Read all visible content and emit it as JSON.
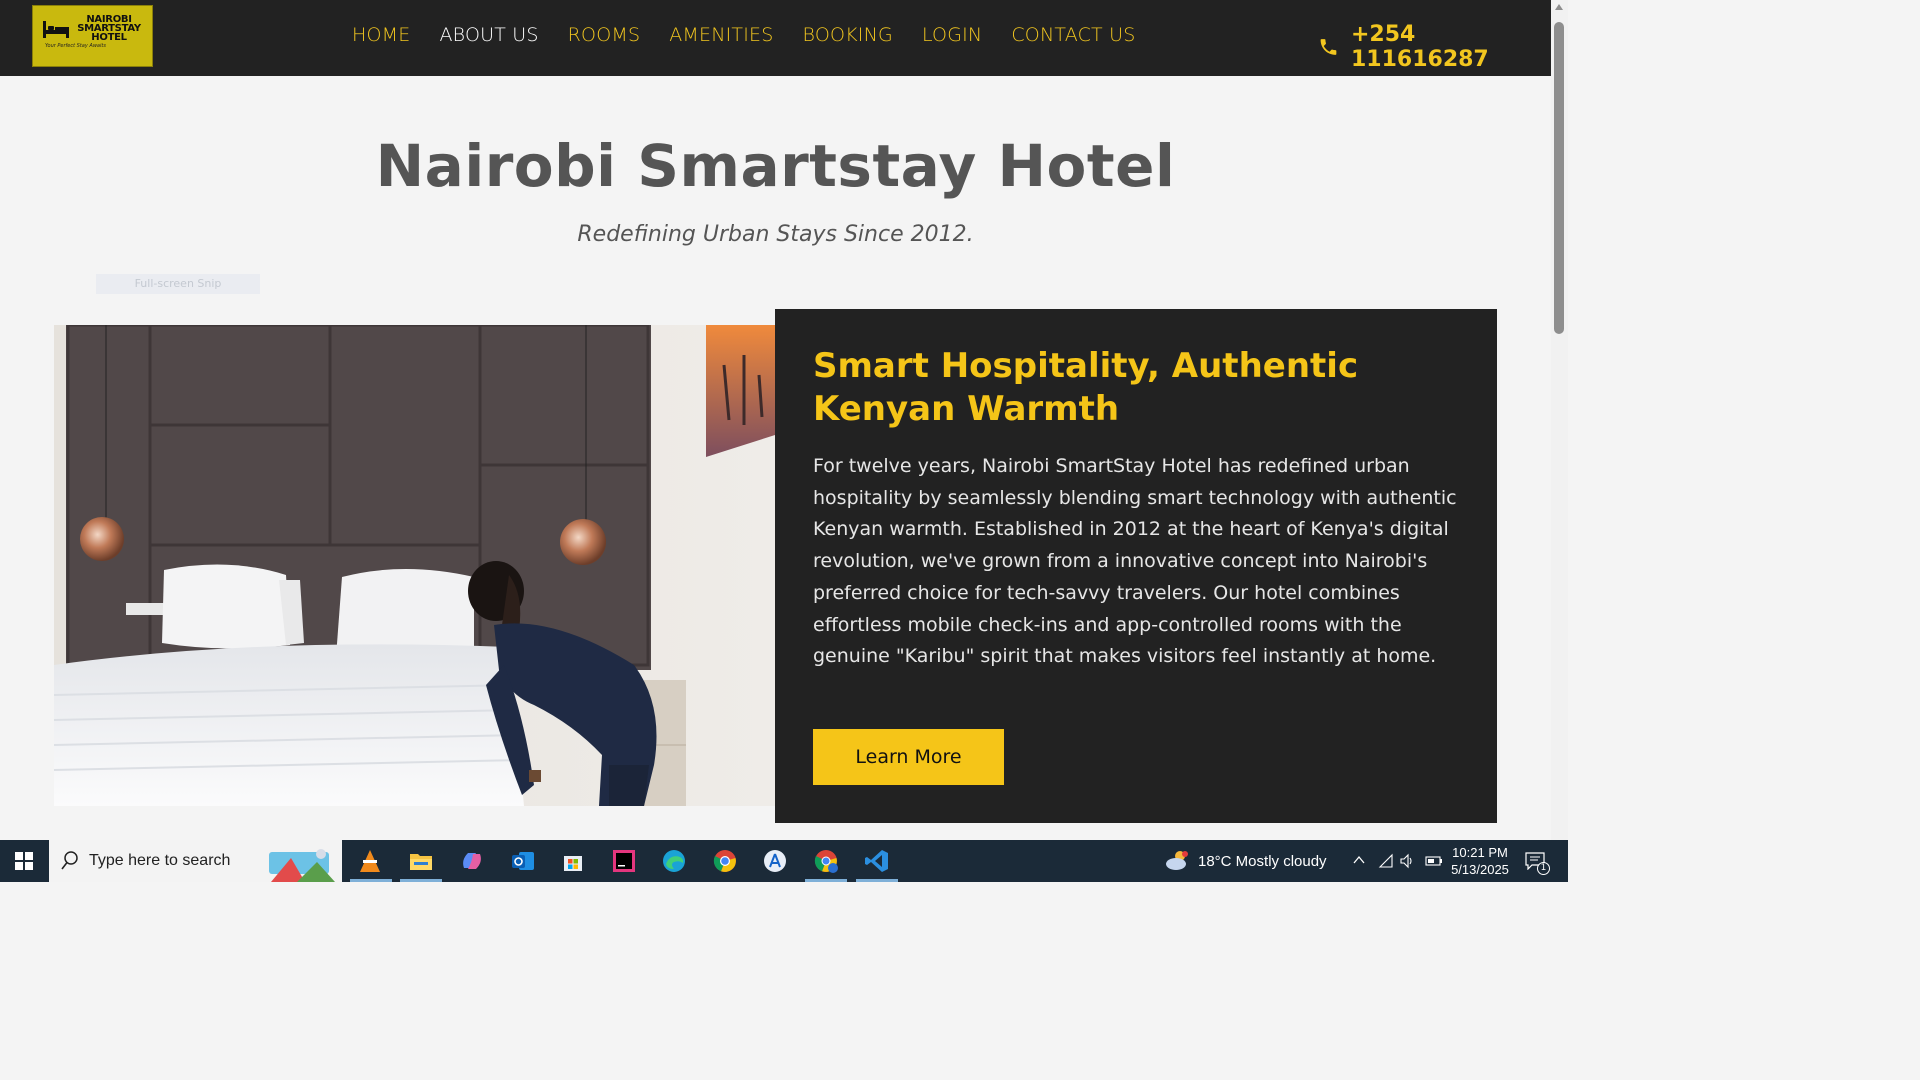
{
  "logo": {
    "line1": "NAIROBI",
    "line2": "SMARTSTAY",
    "line3": "HOTEL",
    "tagline": "Your Perfect Stay Awaits"
  },
  "nav": {
    "items": [
      {
        "label": "HOME"
      },
      {
        "label": "ABOUT US",
        "active": true
      },
      {
        "label": "ROOMS"
      },
      {
        "label": "AMENITIES"
      },
      {
        "label": "BOOKING"
      },
      {
        "label": "LOGIN"
      },
      {
        "label": "CONTACT US"
      }
    ],
    "phone": "+254 111616287"
  },
  "hero": {
    "title": "Nairobi Smartstay Hotel",
    "subtitle": "Redefining Urban Stays Since 2012."
  },
  "overlay": {
    "snip_label": "Full-screen Snip"
  },
  "about": {
    "heading": "Smart Hospitality, Authentic Kenyan Warmth",
    "body": "For twelve years, Nairobi SmartStay Hotel has redefined urban hospitality by seamlessly blending smart technology with authentic Kenyan warmth. Established in 2012 at the heart of Kenya's digital revolution, we've grown from a innovative concept into Nairobi's preferred choice for tech-savvy travelers. Our hotel combines effortless mobile check-ins and app-controlled rooms with the genuine \"Karibu\" spirit that makes visitors feel instantly at home.",
    "button": "Learn More"
  },
  "colors": {
    "accent": "#f5c518",
    "dark": "#222222",
    "heading_gray": "#555555"
  },
  "taskbar": {
    "search_placeholder": "Type here to search",
    "weather": "18°C  Mostly cloudy",
    "time": "10:21 PM",
    "date": "5/13/2025",
    "notifications": "1",
    "apps": [
      "vlc-icon",
      "file-explorer-icon",
      "copilot-icon",
      "outlook-icon",
      "store-icon",
      "intellij-icon",
      "edge-icon",
      "chrome-icon",
      "app-store-icon",
      "chrome-profile-icon",
      "vscode-icon"
    ]
  }
}
